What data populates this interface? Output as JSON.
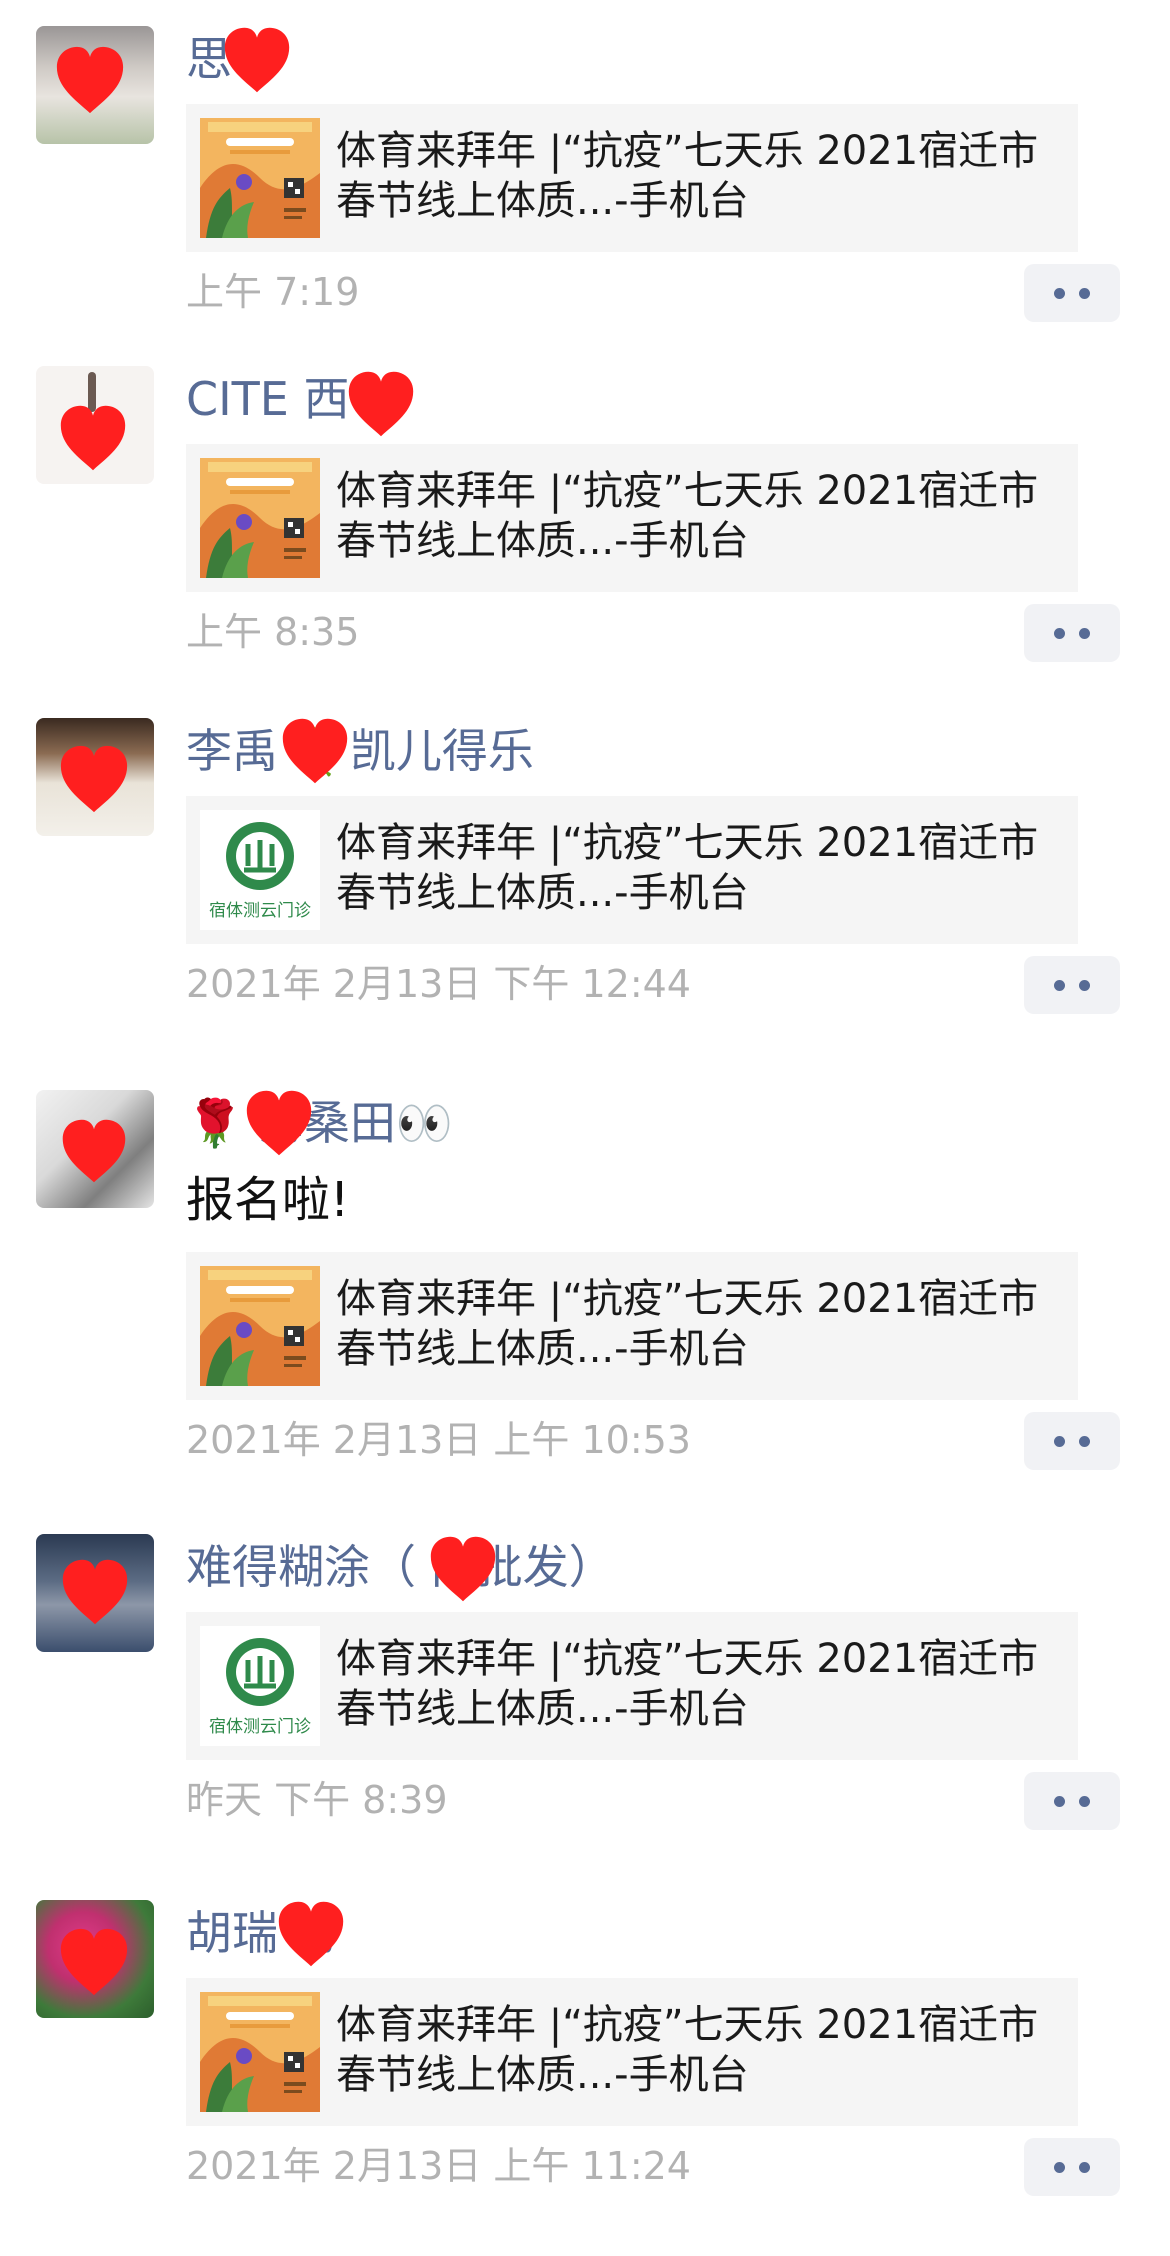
{
  "colors": {
    "name": "#576b95",
    "time": "#b2b2b2",
    "card_bg": "#f5f5f5",
    "heart": "#ff1f1f"
  },
  "link": {
    "title": "体育来拜年 |“抗疫”七天乐 2021宿迁市春节线上体质...-手机台",
    "thumb_types": [
      "poster",
      "clinic-logo"
    ],
    "clinic_logo_text": "宿体测云门诊"
  },
  "posts": [
    {
      "name": "思",
      "text": "",
      "thumb": "poster",
      "time": "上午 7:19"
    },
    {
      "name": "CITE 西",
      "text": "",
      "thumb": "poster",
      "time": "上午 8:35"
    },
    {
      "name": "李禹  🍀凯儿得乐",
      "text": "",
      "thumb": "clinic-logo",
      "time": "2021年 2月13日 下午 12:44"
    },
    {
      "name": "🌹  海桑田👀",
      "text": "报名啦!",
      "thumb": "poster",
      "time": "2021年 2月13日 上午 10:53"
    },
    {
      "name": "难得糊涂（ 肉批发）",
      "text": "",
      "thumb": "clinic-logo",
      "time": "昨天 下午 8:39"
    },
    {
      "name": "胡瑞  男",
      "text": "",
      "thumb": "poster",
      "time": "2021年 2月13日 上午 11:24"
    }
  ],
  "icons": {
    "more": "more-dots-icon",
    "heart": "heart-icon"
  }
}
